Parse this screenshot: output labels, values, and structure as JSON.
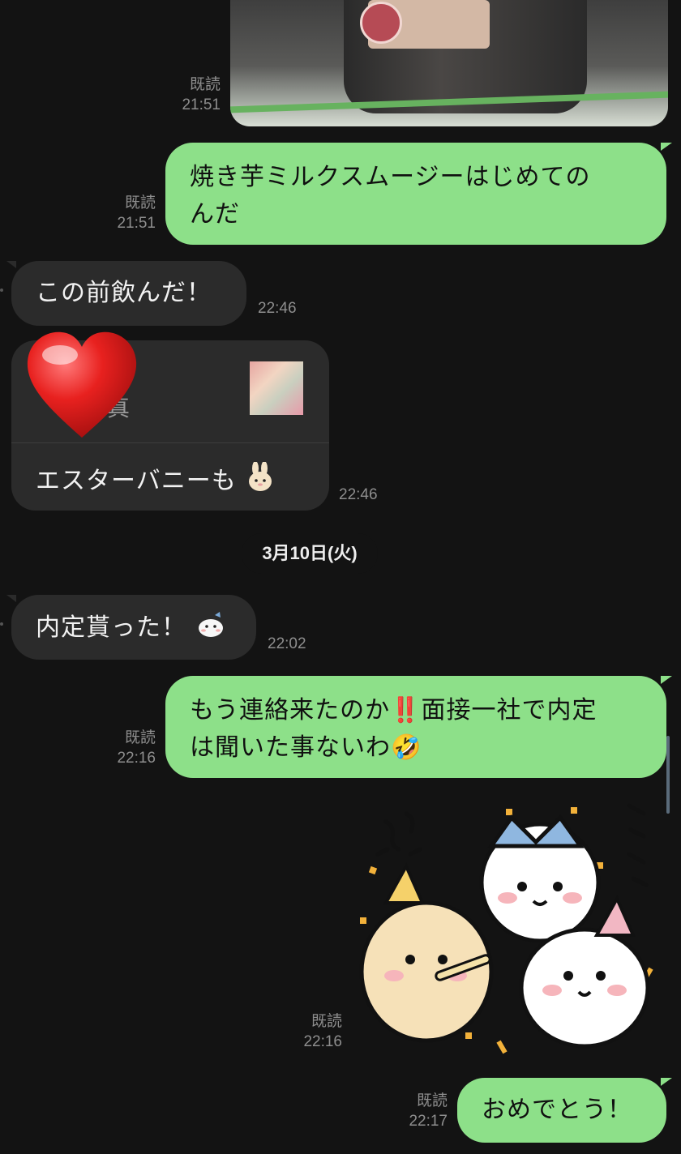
{
  "messages": [
    {
      "id": "m1",
      "direction": "out",
      "type": "image",
      "read": "既読",
      "time": "21:51"
    },
    {
      "id": "m2",
      "direction": "out",
      "type": "text",
      "lines": [
        "焼き芋ミルクスムージーはじめての",
        "んだ"
      ],
      "read": "既読",
      "time": "21:51"
    },
    {
      "id": "m3",
      "direction": "in",
      "type": "text",
      "text": "この前飲んだ！",
      "time": "22:46"
    },
    {
      "id": "m4",
      "direction": "in",
      "type": "reply",
      "quote_label": "真",
      "text": "エスターバニーも",
      "reaction": "heart-reaction",
      "time": "22:46"
    },
    {
      "id": "m5",
      "direction": "in",
      "type": "text",
      "text": "内定貰った！",
      "time": "22:02"
    },
    {
      "id": "m6",
      "direction": "out",
      "type": "text",
      "lines": [
        "もう連絡来たのか‼️面接一社で内定",
        "は聞いた事ないわ🤣"
      ],
      "read": "既読",
      "time": "22:16"
    },
    {
      "id": "m7",
      "direction": "out",
      "type": "sticker",
      "read": "既読",
      "time": "22:16"
    },
    {
      "id": "m8",
      "direction": "out",
      "type": "text",
      "text": "おめでとう！",
      "read": "既読",
      "time": "22:17"
    }
  ],
  "date_separator": "3月10日(火)",
  "colors": {
    "background": "#131313",
    "outgoing_bubble": "#8de089",
    "incoming_bubble": "#2b2b2b",
    "meta_text": "#8e8e8e"
  }
}
